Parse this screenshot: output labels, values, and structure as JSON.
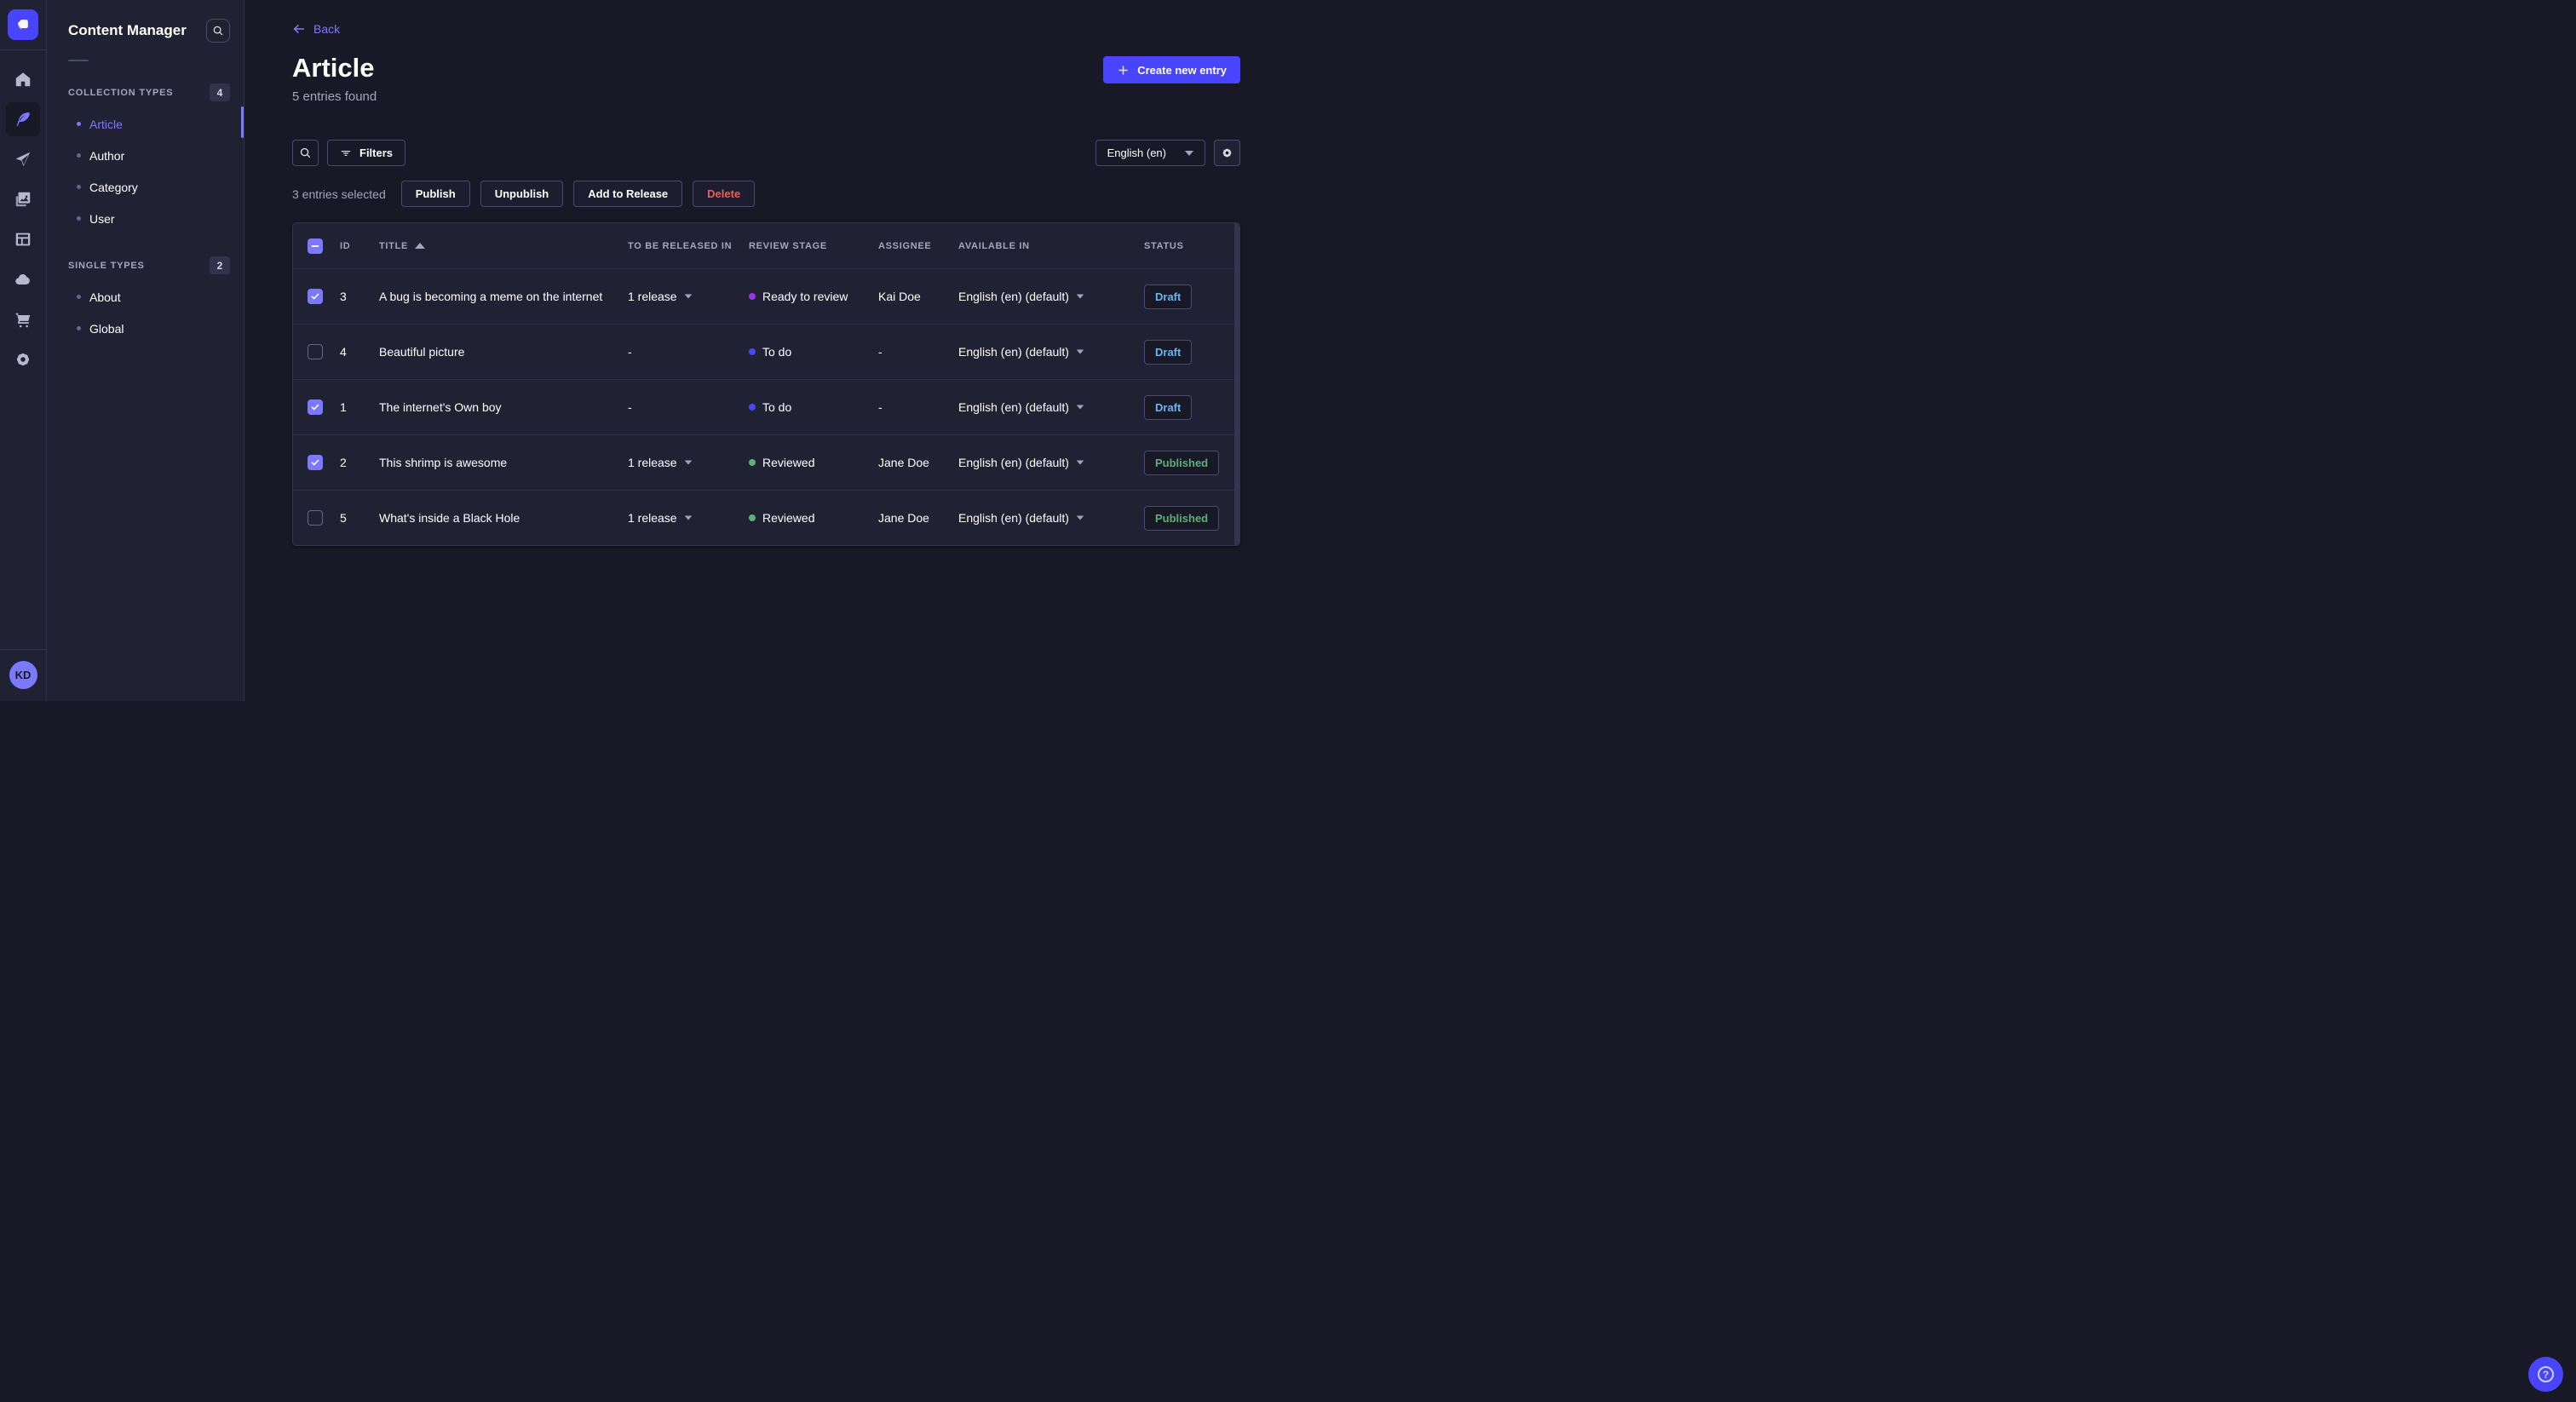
{
  "app": {
    "avatar_initials": "KD",
    "rail_items": [
      "home",
      "content-manager",
      "releases",
      "media-library",
      "content-type-builder",
      "deploy",
      "marketplace",
      "settings"
    ]
  },
  "subnav": {
    "title": "Content Manager",
    "sections": [
      {
        "label": "COLLECTION TYPES",
        "badge": "4",
        "items": [
          {
            "label": "Article"
          },
          {
            "label": "Author"
          },
          {
            "label": "Category"
          },
          {
            "label": "User"
          }
        ]
      },
      {
        "label": "SINGLE TYPES",
        "badge": "2",
        "items": [
          {
            "label": "About"
          },
          {
            "label": "Global"
          }
        ]
      }
    ]
  },
  "header": {
    "back_label": "Back",
    "title": "Article",
    "subtitle": "5 entries found",
    "create_label": "Create new entry"
  },
  "toolbar": {
    "filters_label": "Filters",
    "locale_value": "English (en)"
  },
  "selection": {
    "text": "3 entries selected",
    "publish_label": "Publish",
    "unpublish_label": "Unpublish",
    "add_to_release_label": "Add to Release",
    "delete_label": "Delete"
  },
  "table": {
    "columns": {
      "id": "ID",
      "title": "TITLE",
      "to_be_released_in": "TO BE RELEASED IN",
      "review_stage": "REVIEW STAGE",
      "assignee": "ASSIGNEE",
      "available_in": "AVAILABLE IN",
      "status": "STATUS"
    },
    "rows": [
      {
        "checked": true,
        "id": "3",
        "title": "A bug is becoming a meme on the internet",
        "release": "1 release",
        "stage": "Ready to review",
        "stage_color": "#9736e8",
        "assignee": "Kai Doe",
        "locale": "English (en) (default)",
        "status": "Draft",
        "status_variant": "draft"
      },
      {
        "checked": false,
        "id": "4",
        "title": "Beautiful picture",
        "release": "-",
        "stage": "To do",
        "stage_color": "#4945ff",
        "assignee": "-",
        "locale": "English (en) (default)",
        "status": "Draft",
        "status_variant": "draft"
      },
      {
        "checked": true,
        "id": "1",
        "title": "The internet's Own boy",
        "release": "-",
        "stage": "To do",
        "stage_color": "#4945ff",
        "assignee": "-",
        "locale": "English (en) (default)",
        "status": "Draft",
        "status_variant": "draft"
      },
      {
        "checked": true,
        "id": "2",
        "title": "This shrimp is awesome",
        "release": "1 release",
        "stage": "Reviewed",
        "stage_color": "#5cb176",
        "assignee": "Jane Doe",
        "locale": "English (en) (default)",
        "status": "Published",
        "status_variant": "published"
      },
      {
        "checked": false,
        "id": "5",
        "title": "What's inside a Black Hole",
        "release": "1 release",
        "stage": "Reviewed",
        "stage_color": "#5cb176",
        "assignee": "Jane Doe",
        "locale": "English (en) (default)",
        "status": "Published",
        "status_variant": "published"
      }
    ]
  },
  "colors": {
    "accent": "#4945ff",
    "accent_light": "#7b79ff",
    "draft_text": "#66b7f1",
    "published_text": "#5cb176",
    "danger_text": "#ee5e52",
    "page_bg": "#181826",
    "panel_bg": "#212134"
  }
}
